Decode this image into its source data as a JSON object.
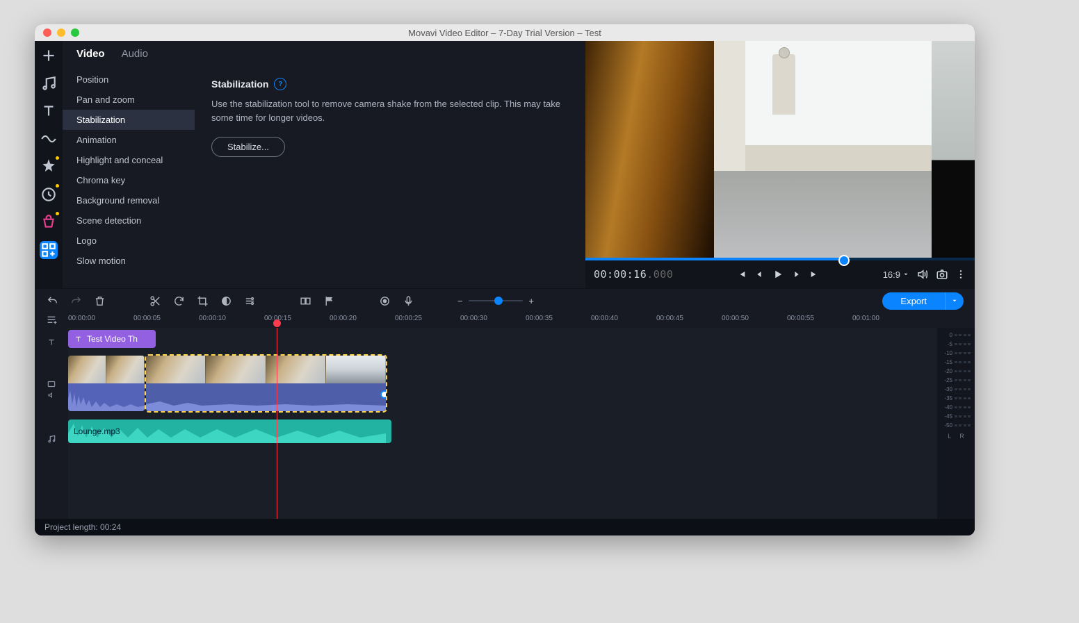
{
  "window_title": "Movavi Video Editor – 7-Day Trial Version – Test",
  "tabs": {
    "video": "Video",
    "audio": "Audio"
  },
  "sublist": {
    "position": "Position",
    "panzoom": "Pan and zoom",
    "stabilization": "Stabilization",
    "animation": "Animation",
    "highlight": "Highlight and conceal",
    "chroma": "Chroma key",
    "bgrem": "Background removal",
    "scene": "Scene detection",
    "logo": "Logo",
    "slowmo": "Slow motion"
  },
  "detail": {
    "heading": "Stabilization",
    "description": "Use the stabilization tool to remove camera shake from the selected clip. This may take some time for longer videos.",
    "button": "Stabilize..."
  },
  "preview": {
    "timecode_main": "00:00:16",
    "timecode_ms": ".000",
    "aspect": "16:9",
    "progress_pct": 66
  },
  "export_label": "Export",
  "ruler_ticks": [
    "00:00:00",
    "00:00:05",
    "00:00:10",
    "00:00:15",
    "00:00:20",
    "00:00:25",
    "00:00:30",
    "00:00:35",
    "00:00:40",
    "00:00:45",
    "00:00:50",
    "00:00:55",
    "00:01:00"
  ],
  "title_clip_label": "Test Video Th",
  "audio_clip_label": "Lounge.mp3",
  "meter_levels": [
    "0",
    "-5",
    "-10",
    "-15",
    "-20",
    "-25",
    "-30",
    "-35",
    "-40",
    "-45",
    "-50"
  ],
  "meter_l": "L",
  "meter_r": "R",
  "status": "Project length: 00:24"
}
